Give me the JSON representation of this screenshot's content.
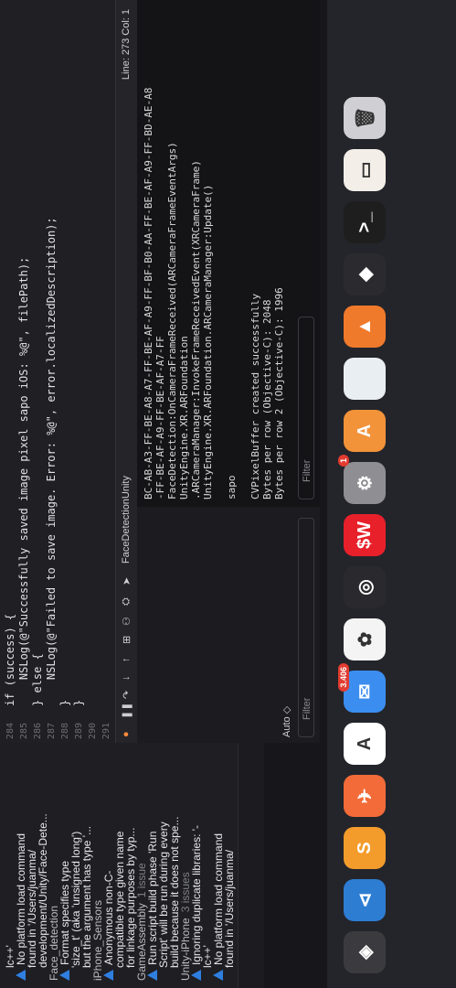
{
  "issues": [
    {
      "kind": "text",
      "text": "lc++'"
    },
    {
      "kind": "warn",
      "text": "No platform load command"
    },
    {
      "kind": "text",
      "text": "found in '/Users/juanma/"
    },
    {
      "kind": "text",
      "text": "development/Unity/Face-Dete..."
    },
    {
      "kind": "group",
      "text": "Face_detection"
    },
    {
      "kind": "warn",
      "text": "Format specifies type"
    },
    {
      "kind": "text",
      "text": "'size_t' (aka 'unsigned long')"
    },
    {
      "kind": "text",
      "text": "but the argument has type '..."
    },
    {
      "kind": "group",
      "text": "iPhone_Sensors"
    },
    {
      "kind": "warn",
      "text": "Anonymous non-C-"
    },
    {
      "kind": "text",
      "text": "compatible type given name"
    },
    {
      "kind": "text",
      "text": "for linkage purposes by typ..."
    },
    {
      "kind": "group",
      "text": "GameAssembly",
      "count": "1 issue"
    },
    {
      "kind": "warn",
      "text": "Run script build phase 'Run"
    },
    {
      "kind": "text",
      "text": "Script' will be run during every"
    },
    {
      "kind": "text",
      "text": "build because it does not spe..."
    },
    {
      "kind": "group",
      "text": "Unity-iPhone",
      "count": "3 issues"
    },
    {
      "kind": "warn",
      "text": "Ignoring duplicate libraries: '-"
    },
    {
      "kind": "text",
      "text": "lc++'"
    },
    {
      "kind": "warn",
      "text": "No platform load command"
    },
    {
      "kind": "text",
      "text": "found in '/Users/juanma/"
    }
  ],
  "editor": {
    "line_numbers": [
      "284",
      "285",
      "286",
      "287",
      "288",
      "289",
      "290",
      "291"
    ],
    "lines": [
      "if (success) {",
      "    NSLog(@\"Successfully saved image pixel sapo iOS: %@\", filePath);",
      "} else {",
      "    NSLog(@\"Failed to save image. Error: %@\", error.localizedDescription);",
      "}",
      "}",
      "",
      ""
    ]
  },
  "debug_bar": {
    "target": "FaceDetectionUnity",
    "position": "Line: 273  Col: 1"
  },
  "variables": {
    "scope": "Auto ◇",
    "filter_placeholder": "Filter"
  },
  "console": {
    "lines": [
      "BC-AB-A3-FF-BE-A8-A7-FF-BE-AF-A9-FF-BF-B0-AA-FF-BE-AF-A9-FF-BD-AE-A8",
      "-FF-BE-AF-A9-FF-BE-AF-A7-FF",
      "FaceDetection:OnCameraFrameReceived(ARCameraFrameEventArgs)",
      "UnityEngine.XR.ARFoundation",
      ".ARCameraManager:InvokeFrameReceivedEvent(XRCameraFrame)",
      "UnityEngine.XR.ARFoundation.ARCameraManager:Update()",
      "",
      "sapo",
      "",
      "CVPixelBuffer created successfully",
      "Bytes per row (Objective-C): 2048",
      "Bytes per row 2 (Objective-C): 1996"
    ],
    "filter_placeholder": "Filter"
  },
  "dock": {
    "icons": [
      {
        "name": "unity-hub",
        "color": "#3b3b3f",
        "glyph": "◈"
      },
      {
        "name": "visual-studio-code",
        "color": "#2d7dd2",
        "glyph": "⊲"
      },
      {
        "name": "sublime-text",
        "color": "#f39c2c",
        "glyph": "S"
      },
      {
        "name": "swift-playgrounds",
        "color": "#f26b38",
        "glyph": "✈"
      },
      {
        "name": "instruments",
        "color": "#ffffff",
        "glyph": "A"
      },
      {
        "name": "mail",
        "color": "#3b8ef0",
        "glyph": "✉",
        "badge": "3.406"
      },
      {
        "name": "photos",
        "color": "#f4f4f4",
        "glyph": "✿"
      },
      {
        "name": "obs",
        "color": "#2a2a2e",
        "glyph": "◎"
      },
      {
        "name": "money-app",
        "color": "#e8202a",
        "glyph": "$W"
      },
      {
        "name": "system-settings",
        "color": "#8e8e93",
        "glyph": "⚙",
        "badge": "1"
      },
      {
        "name": "app-store",
        "color": "#f2933a",
        "glyph": "A"
      },
      {
        "name": "notes",
        "color": "#e9eef3",
        "glyph": ""
      },
      {
        "name": "docker",
        "color": "#f07a2b",
        "glyph": "▲"
      },
      {
        "name": "unity",
        "color": "#2b2b2f",
        "glyph": "◆"
      },
      {
        "name": "terminal",
        "color": "#1e1e1e",
        "glyph": ">_"
      },
      {
        "name": "preview",
        "color": "#f3efe8",
        "glyph": "▭"
      },
      {
        "name": "trash",
        "color": "#cfcfd4",
        "glyph": "🗑"
      }
    ]
  }
}
